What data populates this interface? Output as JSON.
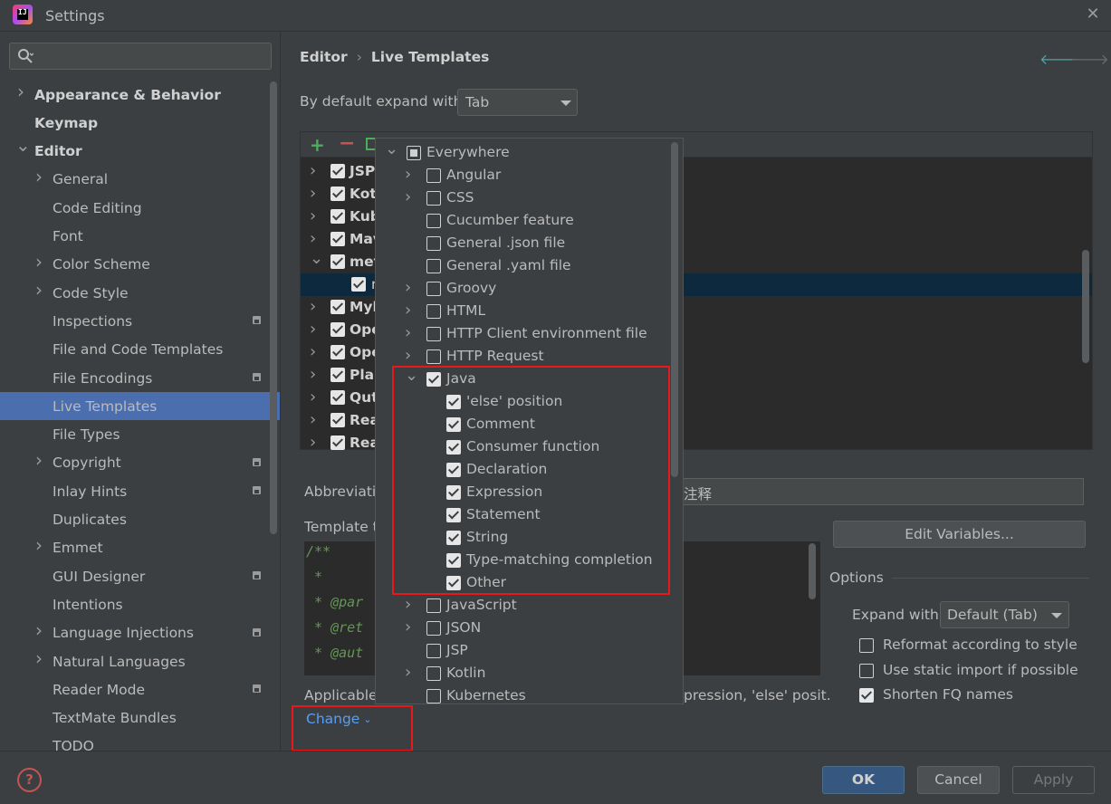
{
  "window": {
    "title": "Settings"
  },
  "sidebar": {
    "search_placeholder": "",
    "items": [
      {
        "label": "Appearance & Behavior",
        "level": 0,
        "arrow": "right"
      },
      {
        "label": "Keymap",
        "level": 0,
        "arrow": ""
      },
      {
        "label": "Editor",
        "level": 0,
        "arrow": "down"
      },
      {
        "label": "General",
        "level": 1,
        "arrow": "right"
      },
      {
        "label": "Code Editing",
        "level": 1,
        "arrow": ""
      },
      {
        "label": "Font",
        "level": 1,
        "arrow": ""
      },
      {
        "label": "Color Scheme",
        "level": 1,
        "arrow": "right"
      },
      {
        "label": "Code Style",
        "level": 1,
        "arrow": "right"
      },
      {
        "label": "Inspections",
        "level": 1,
        "arrow": "",
        "badge": true
      },
      {
        "label": "File and Code Templates",
        "level": 1,
        "arrow": ""
      },
      {
        "label": "File Encodings",
        "level": 1,
        "arrow": "",
        "badge": true
      },
      {
        "label": "Live Templates",
        "level": 1,
        "arrow": "",
        "selected": true
      },
      {
        "label": "File Types",
        "level": 1,
        "arrow": ""
      },
      {
        "label": "Copyright",
        "level": 1,
        "arrow": "right",
        "badge": true
      },
      {
        "label": "Inlay Hints",
        "level": 1,
        "arrow": "",
        "badge": true
      },
      {
        "label": "Duplicates",
        "level": 1,
        "arrow": ""
      },
      {
        "label": "Emmet",
        "level": 1,
        "arrow": "right"
      },
      {
        "label": "GUI Designer",
        "level": 1,
        "arrow": "",
        "badge": true
      },
      {
        "label": "Intentions",
        "level": 1,
        "arrow": ""
      },
      {
        "label": "Language Injections",
        "level": 1,
        "arrow": "right",
        "badge": true
      },
      {
        "label": "Natural Languages",
        "level": 1,
        "arrow": "right"
      },
      {
        "label": "Reader Mode",
        "level": 1,
        "arrow": "",
        "badge": true
      },
      {
        "label": "TextMate Bundles",
        "level": 1,
        "arrow": ""
      },
      {
        "label": "TODO",
        "level": 1,
        "arrow": ""
      }
    ]
  },
  "breadcrumb": {
    "parent": "Editor",
    "separator": "›",
    "current": "Live Templates"
  },
  "expand_default": {
    "label": "By default expand with",
    "value": "Tab"
  },
  "template_tree": [
    {
      "name": "JSP",
      "checked": true,
      "expanded": false
    },
    {
      "name": "Kotl",
      "checked": true,
      "expanded": false
    },
    {
      "name": "Kub",
      "checked": true,
      "expanded": false
    },
    {
      "name": "Mav",
      "checked": true,
      "expanded": false
    },
    {
      "name": "met",
      "checked": true,
      "expanded": true
    },
    {
      "name": "n",
      "checked": true,
      "child": true,
      "selected": true
    },
    {
      "name": "Myb",
      "checked": true,
      "expanded": false
    },
    {
      "name": "Ope",
      "checked": true,
      "expanded": false
    },
    {
      "name": "Ope",
      "checked": true,
      "expanded": false
    },
    {
      "name": "Plan",
      "checked": true,
      "expanded": false
    },
    {
      "name": "Qut",
      "checked": true,
      "expanded": false
    },
    {
      "name": "Rea",
      "checked": true,
      "expanded": false
    },
    {
      "name": "Rea",
      "checked": true,
      "expanded": false
    }
  ],
  "abbreviation": {
    "label": "Abbreviatio",
    "description_value": "注释"
  },
  "template_text": {
    "label": "Template t",
    "lines": [
      "/**",
      " *",
      " * @par",
      " * @ret",
      " * @aut"
    ]
  },
  "edit_variables_label": "Edit Variables...",
  "options": {
    "title": "Options",
    "expand_with_label": "Expand with",
    "expand_with_value": "Default (Tab)",
    "checkboxes": [
      {
        "label": "Reformat according to style",
        "checked": false
      },
      {
        "label": "Use static import if possible",
        "checked": false
      },
      {
        "label": "Shorten FQ names",
        "checked": true
      }
    ]
  },
  "applicable": {
    "label": "Applicable",
    "tail": "pression, 'else' posit.",
    "change_label": "Change"
  },
  "context_popup": [
    {
      "label": "Everywhere",
      "state": "part",
      "arrow": "down",
      "level": 0
    },
    {
      "label": "Angular",
      "state": "off",
      "arrow": "right",
      "level": 1
    },
    {
      "label": "CSS",
      "state": "off",
      "arrow": "right",
      "level": 1
    },
    {
      "label": "Cucumber feature",
      "state": "off",
      "arrow": "",
      "level": 1
    },
    {
      "label": "General .json file",
      "state": "off",
      "arrow": "",
      "level": 1
    },
    {
      "label": "General .yaml file",
      "state": "off",
      "arrow": "",
      "level": 1
    },
    {
      "label": "Groovy",
      "state": "off",
      "arrow": "right",
      "level": 1
    },
    {
      "label": "HTML",
      "state": "off",
      "arrow": "right",
      "level": 1
    },
    {
      "label": "HTTP Client environment file",
      "state": "off",
      "arrow": "right",
      "level": 1
    },
    {
      "label": "HTTP Request",
      "state": "off",
      "arrow": "right",
      "level": 1
    },
    {
      "label": "Java",
      "state": "on",
      "arrow": "down",
      "level": 1
    },
    {
      "label": "'else' position",
      "state": "on",
      "arrow": "",
      "level": 2
    },
    {
      "label": "Comment",
      "state": "on",
      "arrow": "",
      "level": 2
    },
    {
      "label": "Consumer function",
      "state": "on",
      "arrow": "",
      "level": 2
    },
    {
      "label": "Declaration",
      "state": "on",
      "arrow": "",
      "level": 2
    },
    {
      "label": "Expression",
      "state": "on",
      "arrow": "",
      "level": 2
    },
    {
      "label": "Statement",
      "state": "on",
      "arrow": "",
      "level": 2
    },
    {
      "label": "String",
      "state": "on",
      "arrow": "",
      "level": 2
    },
    {
      "label": "Type-matching completion",
      "state": "on",
      "arrow": "",
      "level": 2
    },
    {
      "label": "Other",
      "state": "on",
      "arrow": "",
      "level": 2
    },
    {
      "label": "JavaScript",
      "state": "off",
      "arrow": "right",
      "level": 1
    },
    {
      "label": "JSON",
      "state": "off",
      "arrow": "right",
      "level": 1
    },
    {
      "label": "JSP",
      "state": "off",
      "arrow": "",
      "level": 1
    },
    {
      "label": "Kotlin",
      "state": "off",
      "arrow": "right",
      "level": 1
    },
    {
      "label": "Kubernetes",
      "state": "off",
      "arrow": "",
      "level": 1
    }
  ],
  "footer": {
    "ok_label": "OK",
    "cancel_label": "Cancel",
    "apply_label": "Apply",
    "help_icon": "?"
  },
  "colors": {
    "accent": "#4b6eaf",
    "link": "#589df6",
    "highlight_box": "#e8191a"
  }
}
